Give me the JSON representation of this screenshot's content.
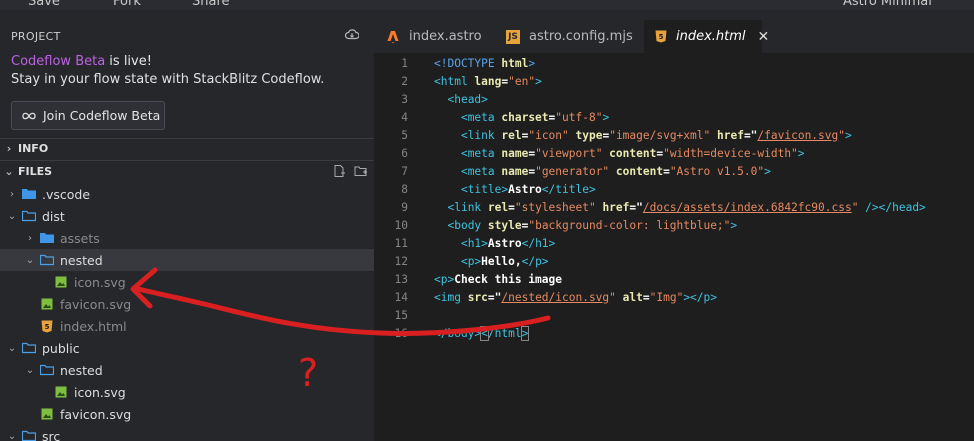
{
  "topbar": {
    "save": "Save",
    "fork": "Fork",
    "share": "Share",
    "project_title": "Astro Minimal Example"
  },
  "sidebar": {
    "header": "PROJECT",
    "promo_brand": "Codeflow Beta",
    "promo_suffix": " is live!",
    "promo_line2": "Stay in your flow state with StackBlitz Codeflow.",
    "join_button": "Join Codeflow Beta",
    "section_info": "INFO",
    "section_files": "FILES",
    "tree": [
      {
        "label": ".vscode",
        "type": "folder",
        "depth": 0,
        "open": false
      },
      {
        "label": "dist",
        "type": "folder",
        "depth": 0,
        "open": true
      },
      {
        "label": "assets",
        "type": "folder",
        "depth": 1,
        "open": false
      },
      {
        "label": "nested",
        "type": "folder",
        "depth": 1,
        "open": true
      },
      {
        "label": "icon.svg",
        "type": "svg",
        "depth": 2
      },
      {
        "label": "favicon.svg",
        "type": "svg",
        "depth": 1
      },
      {
        "label": "index.html",
        "type": "html",
        "depth": 1
      },
      {
        "label": "public",
        "type": "folder",
        "depth": 0,
        "open": true
      },
      {
        "label": "nested",
        "type": "folder",
        "depth": 1,
        "open": true
      },
      {
        "label": "icon.svg",
        "type": "svg",
        "depth": 2
      },
      {
        "label": "favicon.svg",
        "type": "svg",
        "depth": 1
      },
      {
        "label": "src",
        "type": "folder",
        "depth": 0,
        "open": true
      }
    ]
  },
  "editor": {
    "tabs": [
      {
        "label": "index.astro",
        "icon": "astro-icon"
      },
      {
        "label": "astro.config.mjs",
        "icon": "js-icon"
      },
      {
        "label": "index.html",
        "icon": "html5-icon",
        "active": true
      }
    ],
    "lines": [
      "1",
      "2",
      "3",
      "4",
      "5",
      "6",
      "7",
      "8",
      "9",
      "10",
      "11",
      "12",
      "13",
      "14",
      "15",
      "16"
    ]
  },
  "annotation": {
    "question_mark": "?"
  },
  "colors": {
    "brand_purple": "#bd63e0",
    "selection": "#37393f",
    "annotation_red": "#d92020"
  }
}
